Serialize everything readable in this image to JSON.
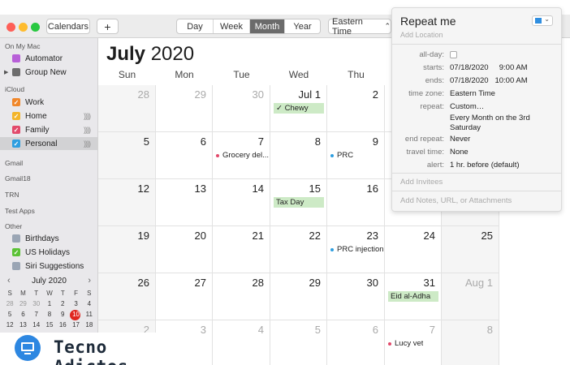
{
  "toolbar": {
    "calendars_label": "Calendars",
    "add_label": "+",
    "views": [
      "Day",
      "Week",
      "Month",
      "Year"
    ],
    "active_view": "Month",
    "timezone_label": "Eastern Time",
    "timezone_chevron": "⌃"
  },
  "sidebar": {
    "groups": [
      {
        "title": "On My Mac",
        "items": [
          {
            "label": "Automator",
            "color": "#b860d8",
            "checked": false
          },
          {
            "label": "Group New",
            "color": "#6d6d6d",
            "checked": false,
            "expandable": true
          }
        ]
      },
      {
        "title": "iCloud",
        "items": [
          {
            "label": "Work",
            "color": "#f0872a",
            "checked": true
          },
          {
            "label": "Home",
            "color": "#f3b52a",
            "checked": true,
            "shared": true
          },
          {
            "label": "Family",
            "color": "#e24a6b",
            "checked": true,
            "shared": true
          },
          {
            "label": "Personal",
            "color": "#2d9ee0",
            "checked": true,
            "shared": true,
            "selected": true
          }
        ]
      },
      {
        "title": "Gmail",
        "items": []
      },
      {
        "title": "Gmail18",
        "items": []
      },
      {
        "title": "TRN",
        "items": []
      },
      {
        "title": "Test Apps",
        "items": []
      },
      {
        "title": "Other",
        "items": [
          {
            "label": "Birthdays",
            "color": "#9aa5b4",
            "checked": false
          },
          {
            "label": "US Holidays",
            "color": "#5bc236",
            "checked": true
          },
          {
            "label": "Siri Suggestions",
            "color": "#9aa5b4",
            "checked": false
          }
        ]
      }
    ],
    "shared_icon": "))))"
  },
  "mini_calendar": {
    "title": "July 2020",
    "prev": "‹",
    "next": "›",
    "dow": [
      "S",
      "M",
      "T",
      "W",
      "T",
      "F",
      "S"
    ],
    "weeks": [
      [
        "28",
        "29",
        "30",
        "1",
        "2",
        "3",
        "4"
      ],
      [
        "5",
        "6",
        "7",
        "8",
        "9",
        "10",
        "11"
      ],
      [
        "12",
        "13",
        "14",
        "15",
        "16",
        "17",
        "18"
      ]
    ],
    "today": "10"
  },
  "main": {
    "month": "July",
    "year": "2020",
    "dow": [
      "Sun",
      "Mon",
      "Tue",
      "Wed",
      "Thu",
      "Fri",
      "Sat"
    ],
    "weeks": [
      [
        {
          "d": "28",
          "dim": true
        },
        {
          "d": "29",
          "dim": true
        },
        {
          "d": "30",
          "dim": true
        },
        {
          "d": "Jul 1"
        },
        {
          "d": "2"
        },
        {
          "d": ""
        },
        {
          "d": ""
        }
      ],
      [
        {
          "d": "5"
        },
        {
          "d": "6"
        },
        {
          "d": "7"
        },
        {
          "d": "8"
        },
        {
          "d": "9"
        },
        {
          "d": ""
        },
        {
          "d": ""
        }
      ],
      [
        {
          "d": "12"
        },
        {
          "d": "13"
        },
        {
          "d": "14"
        },
        {
          "d": "15"
        },
        {
          "d": "16"
        },
        {
          "d": ""
        },
        {
          "d": ""
        }
      ],
      [
        {
          "d": "19"
        },
        {
          "d": "20"
        },
        {
          "d": "21"
        },
        {
          "d": "22"
        },
        {
          "d": "23"
        },
        {
          "d": "24"
        },
        {
          "d": "25"
        }
      ],
      [
        {
          "d": "26"
        },
        {
          "d": "27"
        },
        {
          "d": "28"
        },
        {
          "d": "29"
        },
        {
          "d": "30"
        },
        {
          "d": "31"
        },
        {
          "d": "Aug 1",
          "dim": true
        }
      ],
      [
        {
          "d": "2",
          "dim": true
        },
        {
          "d": "3",
          "dim": true
        },
        {
          "d": "4",
          "dim": true
        },
        {
          "d": "5",
          "dim": true
        },
        {
          "d": "6",
          "dim": true
        },
        {
          "d": "7",
          "dim": true
        },
        {
          "d": "8",
          "dim": true
        }
      ]
    ],
    "events": [
      {
        "week": 0,
        "day": 3,
        "label": "✓ Chewy",
        "style": "green"
      },
      {
        "week": 1,
        "day": 2,
        "label": "Grocery del...",
        "style": "dot",
        "color": "#e24a6b"
      },
      {
        "week": 1,
        "day": 4,
        "label": "PRC",
        "style": "dot",
        "color": "#2d9ee0"
      },
      {
        "week": 2,
        "day": 3,
        "label": "Tax Day",
        "style": "green"
      },
      {
        "week": 3,
        "day": 4,
        "label": "PRC injection",
        "style": "dot",
        "color": "#2d9ee0"
      },
      {
        "week": 4,
        "day": 5,
        "label": "Eid al-Adha",
        "style": "green"
      },
      {
        "week": 5,
        "day": 5,
        "label": "Lucy vet",
        "style": "dot",
        "color": "#e24a6b"
      }
    ]
  },
  "popover": {
    "title": "Repeat me",
    "location_placeholder": "Add Location",
    "calendar_color": "#2f8ee0",
    "rows": [
      {
        "label": "all-day:",
        "value": "",
        "checkbox": true
      },
      {
        "label": "starts:",
        "value": "07/18/2020     9:00 AM"
      },
      {
        "label": "ends:",
        "value": "07/18/2020   10:00 AM"
      },
      {
        "label": "time zone:",
        "value": "Eastern Time"
      },
      {
        "label": "repeat:",
        "value": "Custom…"
      },
      {
        "label": "",
        "value": "Every Month on the 3rd"
      },
      {
        "label": "",
        "value": "Saturday"
      },
      {
        "label": "end repeat:",
        "value": "Never"
      },
      {
        "label": "travel time:",
        "value": "None"
      },
      {
        "label": "alert:",
        "value": "1 hr. before (default)"
      }
    ],
    "invitees_placeholder": "Add Invitees",
    "notes_placeholder": "Add Notes, URL, or Attachments"
  },
  "watermark": {
    "text": "Tecno Adictos"
  }
}
